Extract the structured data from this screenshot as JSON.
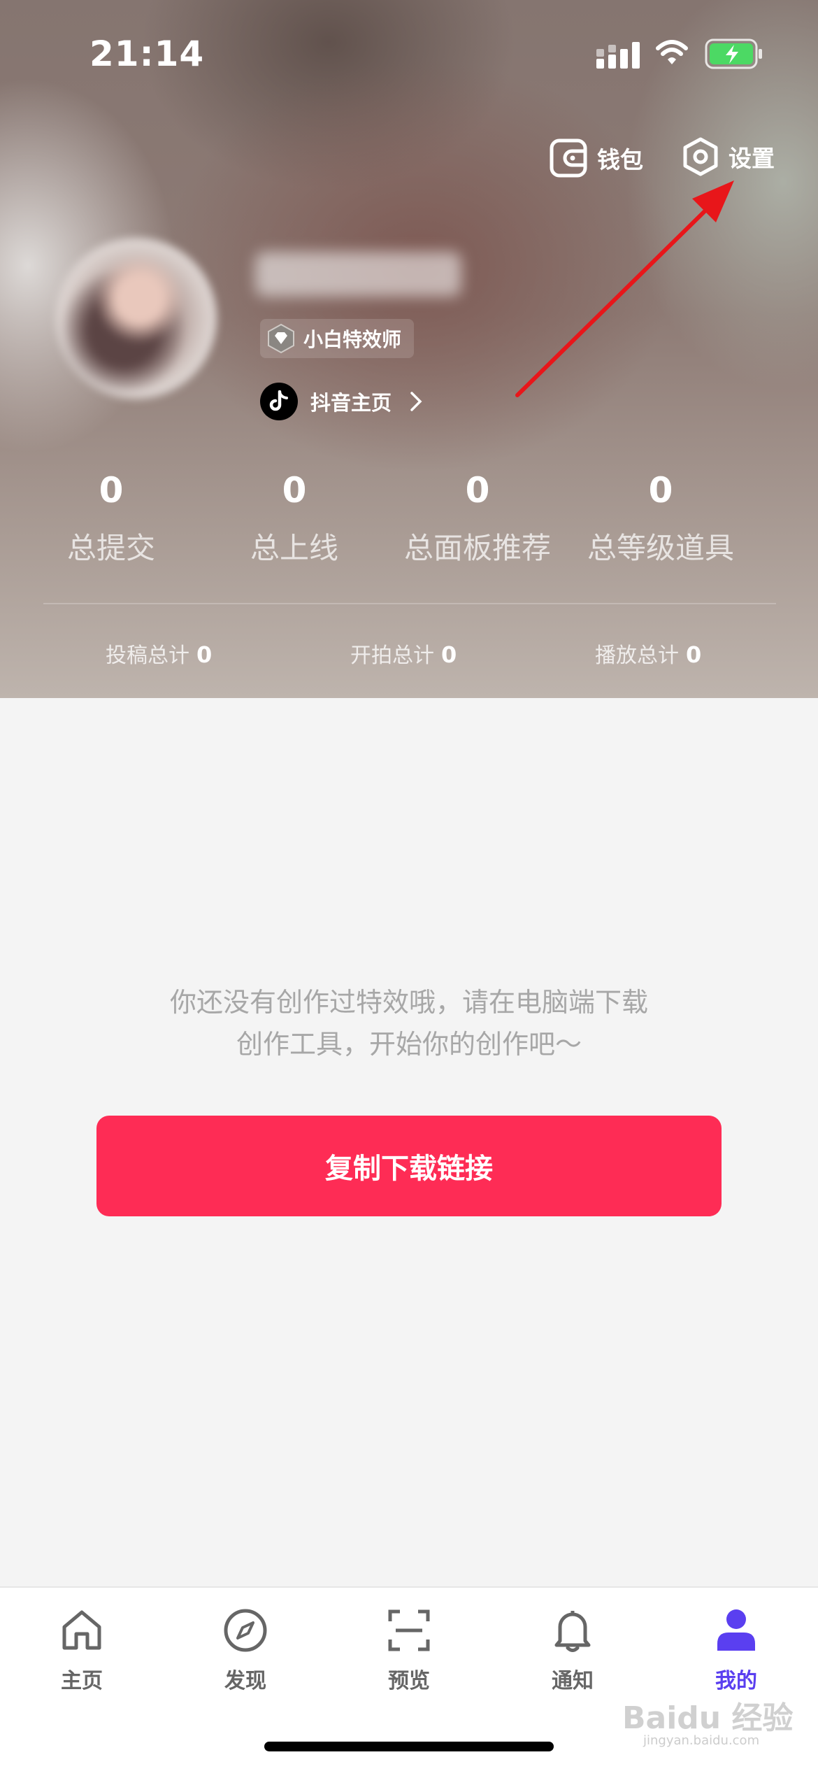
{
  "status_bar": {
    "time": "21:14"
  },
  "top_actions": {
    "wallet": "钱包",
    "settings": "设置"
  },
  "profile": {
    "badge": "小白特效师",
    "douyin_link": "抖音主页"
  },
  "stats": [
    {
      "value": "0",
      "label": "总提交"
    },
    {
      "value": "0",
      "label": "总上线"
    },
    {
      "value": "0",
      "label": "总面板推荐"
    },
    {
      "value": "0",
      "label": "总等级道具"
    }
  ],
  "totals": [
    {
      "label": "投稿总计",
      "value": "0"
    },
    {
      "label": "开拍总计",
      "value": "0"
    },
    {
      "label": "播放总计",
      "value": "0"
    }
  ],
  "empty_state": {
    "line1": "你还没有创作过特效哦，请在电脑端下载",
    "line2": "创作工具，开始你的创作吧～",
    "button": "复制下载链接"
  },
  "tabs": [
    {
      "label": "主页",
      "icon": "home-icon"
    },
    {
      "label": "发现",
      "icon": "compass-icon"
    },
    {
      "label": "预览",
      "icon": "scan-icon"
    },
    {
      "label": "通知",
      "icon": "bell-icon"
    },
    {
      "label": "我的",
      "icon": "user-icon",
      "active": true
    }
  ],
  "watermark": {
    "brand": "Baidu 经验",
    "url": "jingyan.baidu.com"
  },
  "colors": {
    "accent": "#fe2c55",
    "active_tab": "#5a3ff0",
    "annotation": "#e8161a"
  }
}
